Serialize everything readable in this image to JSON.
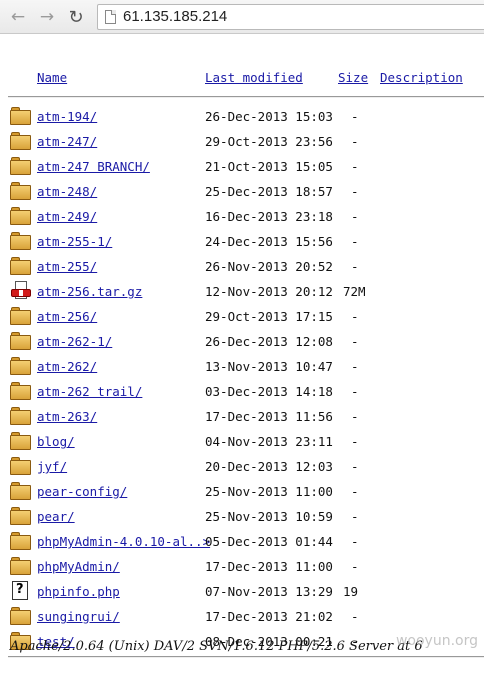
{
  "browser": {
    "url": "61.135.185.214",
    "back_icon": "back-arrow-icon",
    "forward_icon": "forward-arrow-icon",
    "reload_icon": "reload-icon"
  },
  "listing": {
    "headers": {
      "name": "Name",
      "last_modified": "Last modified",
      "size": "Size",
      "description": "Description"
    },
    "entries": [
      {
        "icon": "folder-icon",
        "name": "atm-194/",
        "modified": "26-Dec-2013 15:03",
        "size": "-"
      },
      {
        "icon": "folder-icon",
        "name": "atm-247/",
        "modified": "29-Oct-2013 23:56",
        "size": "-"
      },
      {
        "icon": "folder-icon",
        "name": "atm-247 BRANCH/",
        "modified": "21-Oct-2013 15:05",
        "size": "-"
      },
      {
        "icon": "folder-icon",
        "name": "atm-248/",
        "modified": "25-Dec-2013 18:57",
        "size": "-"
      },
      {
        "icon": "folder-icon",
        "name": "atm-249/",
        "modified": "16-Dec-2013 23:18",
        "size": "-"
      },
      {
        "icon": "folder-icon",
        "name": "atm-255-1/",
        "modified": "24-Dec-2013 15:56",
        "size": "-"
      },
      {
        "icon": "folder-icon",
        "name": "atm-255/",
        "modified": "26-Nov-2013 20:52",
        "size": "-"
      },
      {
        "icon": "archive-icon",
        "name": "atm-256.tar.gz",
        "modified": "12-Nov-2013 20:12",
        "size": "72M"
      },
      {
        "icon": "folder-icon",
        "name": "atm-256/",
        "modified": "29-Oct-2013 17:15",
        "size": "-"
      },
      {
        "icon": "folder-icon",
        "name": "atm-262-1/",
        "modified": "26-Dec-2013 12:08",
        "size": "-"
      },
      {
        "icon": "folder-icon",
        "name": "atm-262/",
        "modified": "13-Nov-2013 10:47",
        "size": "-"
      },
      {
        "icon": "folder-icon",
        "name": "atm-262 trail/",
        "modified": "03-Dec-2013 14:18",
        "size": "-"
      },
      {
        "icon": "folder-icon",
        "name": "atm-263/",
        "modified": "17-Dec-2013 11:56",
        "size": "-"
      },
      {
        "icon": "folder-icon",
        "name": "blog/",
        "modified": "04-Nov-2013 23:11",
        "size": "-"
      },
      {
        "icon": "folder-icon",
        "name": "jyf/",
        "modified": "20-Dec-2013 12:03",
        "size": "-"
      },
      {
        "icon": "folder-icon",
        "name": "pear-config/",
        "modified": "25-Nov-2013 11:00",
        "size": "-"
      },
      {
        "icon": "folder-icon",
        "name": "pear/",
        "modified": "25-Nov-2013 10:59",
        "size": "-"
      },
      {
        "icon": "folder-icon",
        "name": "phpMyAdmin-4.0.10-al..>",
        "modified": "05-Dec-2013 01:44",
        "size": "-"
      },
      {
        "icon": "folder-icon",
        "name": "phpMyAdmin/",
        "modified": "17-Dec-2013 11:00",
        "size": "-"
      },
      {
        "icon": "unknown-file-icon",
        "name": "phpinfo.php",
        "modified": "07-Nov-2013 13:29",
        "size": "19"
      },
      {
        "icon": "folder-icon",
        "name": "sungingrui/",
        "modified": "17-Dec-2013 21:02",
        "size": "-"
      },
      {
        "icon": "folder-icon",
        "name": "test/",
        "modified": "08-Dec-2013 00:21",
        "size": "-"
      }
    ]
  },
  "server_signature": "Apache/2.0.64 (Unix) DAV/2 SVN/1.6.12 PHP/5.2.6 Server at 6",
  "watermark": "wooyun.org"
}
